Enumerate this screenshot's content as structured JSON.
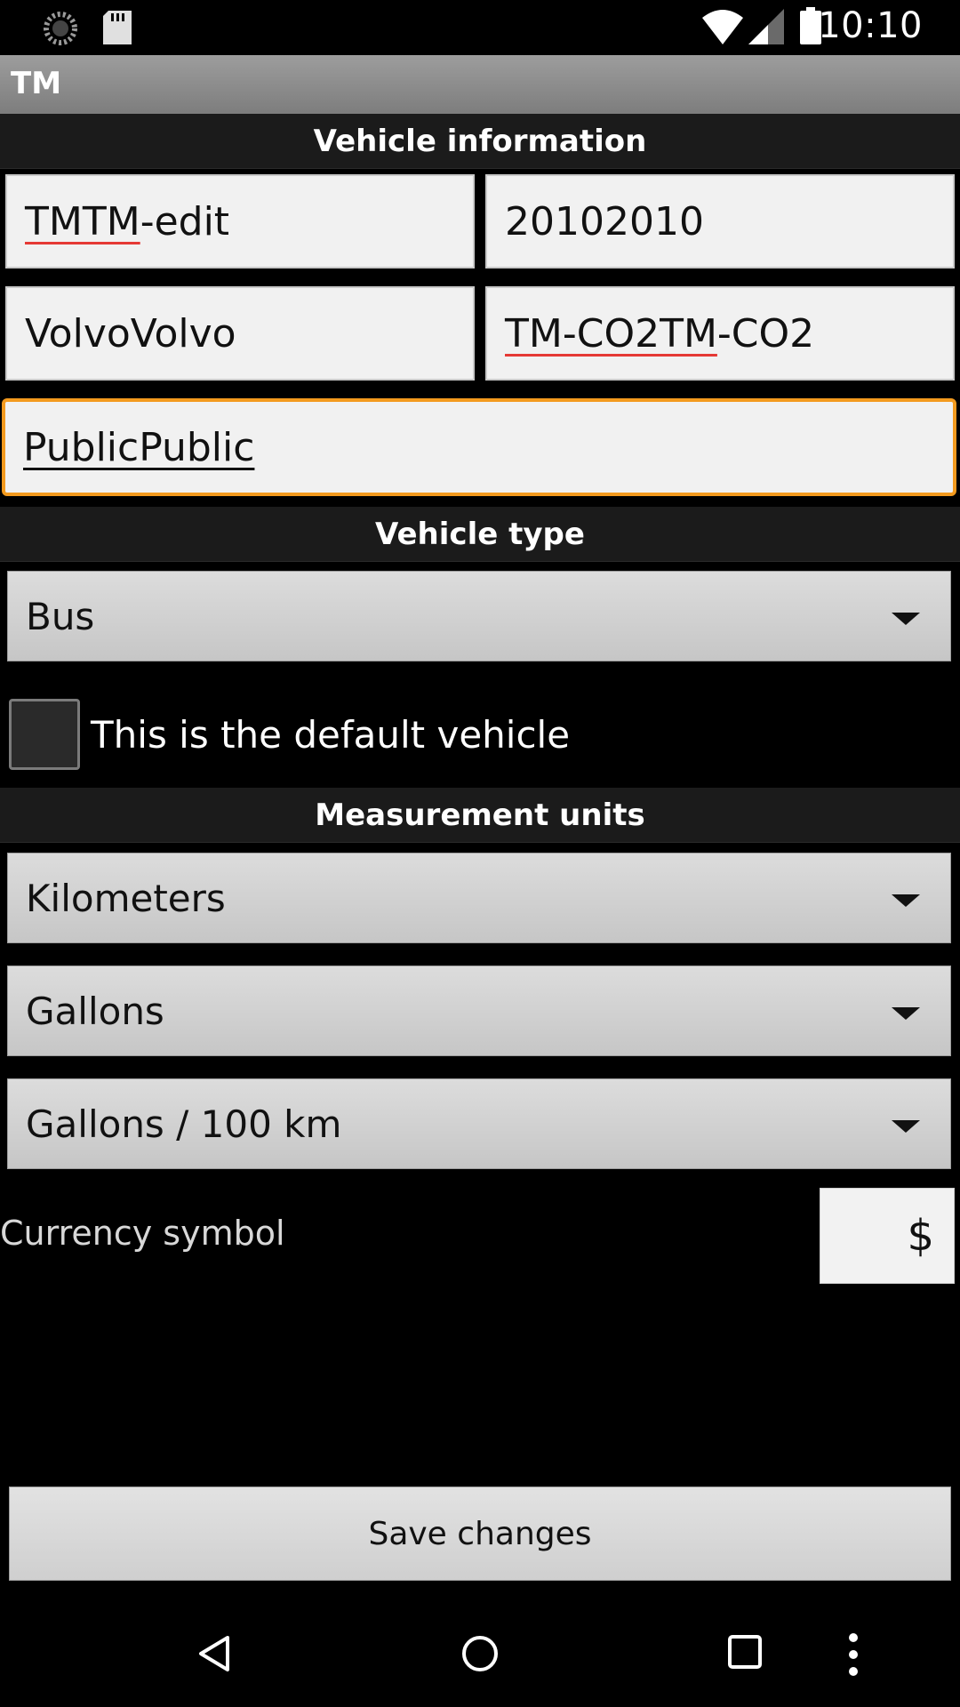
{
  "status_bar": {
    "time": "10:10",
    "left_icons": [
      "loading-spinner-icon",
      "sd-card-icon"
    ],
    "right_icons": [
      "wifi-icon",
      "signal-icon",
      "battery-icon"
    ]
  },
  "app": {
    "title": "TM"
  },
  "sections": {
    "vehicle_information": "Vehicle information",
    "vehicle_type": "Vehicle type",
    "measurement_units": "Measurement units"
  },
  "fields": {
    "name": {
      "underlined": "TMTM",
      "rest": "-edit"
    },
    "year": "20102010",
    "make": "VolvoVolvo",
    "model": {
      "underlined": "TM-CO2TM",
      "rest": "-CO2"
    },
    "usage": "PublicPublic"
  },
  "vehicle_type": {
    "selected": "Bus"
  },
  "default_vehicle": {
    "label": "This is the default vehicle",
    "checked": false
  },
  "units": {
    "distance": "Kilometers",
    "volume": "Gallons",
    "consumption": "Gallons / 100 km"
  },
  "currency": {
    "label": "Currency symbol",
    "value": "$"
  },
  "actions": {
    "save_label": "Save changes"
  },
  "nav": {
    "icons": [
      "back-icon",
      "home-icon",
      "recents-icon",
      "more-icon"
    ]
  },
  "colors": {
    "focus": "#f39a1e",
    "spellcheck": "#e53935"
  }
}
